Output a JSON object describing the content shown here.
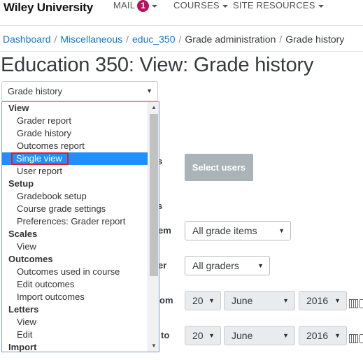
{
  "navbar": {
    "brand": "Wiley University",
    "mail_label": "MAIL",
    "mail_count": "1",
    "courses_label": "COURSES",
    "site_resources_label": "SITE RESOURCES"
  },
  "breadcrumb": {
    "items": [
      "Dashboard",
      "Miscellaneous",
      "educ_350",
      "Grade administration",
      "Grade history"
    ]
  },
  "page": {
    "title": "Education 350: View: Grade history"
  },
  "jump_select": {
    "value": "Grade history",
    "groups": [
      {
        "label": "View",
        "options": [
          "Grader report",
          "Grade history",
          "Outcomes report",
          "Single view",
          "User report"
        ]
      },
      {
        "label": "Setup",
        "options": [
          "Gradebook setup",
          "Course grade settings",
          "Preferences: Grader report"
        ]
      },
      {
        "label": "Scales",
        "options": [
          "View"
        ]
      },
      {
        "label": "Outcomes",
        "options": [
          "Outcomes used in course",
          "Edit outcomes",
          "Import outcomes"
        ]
      },
      {
        "label": "Letters",
        "options": [
          "View",
          "Edit"
        ]
      },
      {
        "label": "Import",
        "options": []
      }
    ],
    "highlighted_option": "Single view"
  },
  "form": {
    "label_users_fragment": "rs",
    "select_users_button": "Select users",
    "label_graders_fragment": "rs",
    "label_item_fragment": "em",
    "grade_items_value": "All grade items",
    "label_grader_fragment": "er",
    "graders_value": "All graders",
    "label_from_fragment": "om",
    "from_day": "20",
    "from_month": "June",
    "from_year": "2016",
    "label_to_fragment": "to",
    "to_day": "20",
    "to_month": "June",
    "to_year": "2016"
  },
  "colors": {
    "brand_link": "#1177d1",
    "badge": "#b3145b",
    "selected_option_bg": "#1e90ff",
    "highlight_outline": "#e41b23",
    "button_disabled": "#a9b3b8"
  }
}
